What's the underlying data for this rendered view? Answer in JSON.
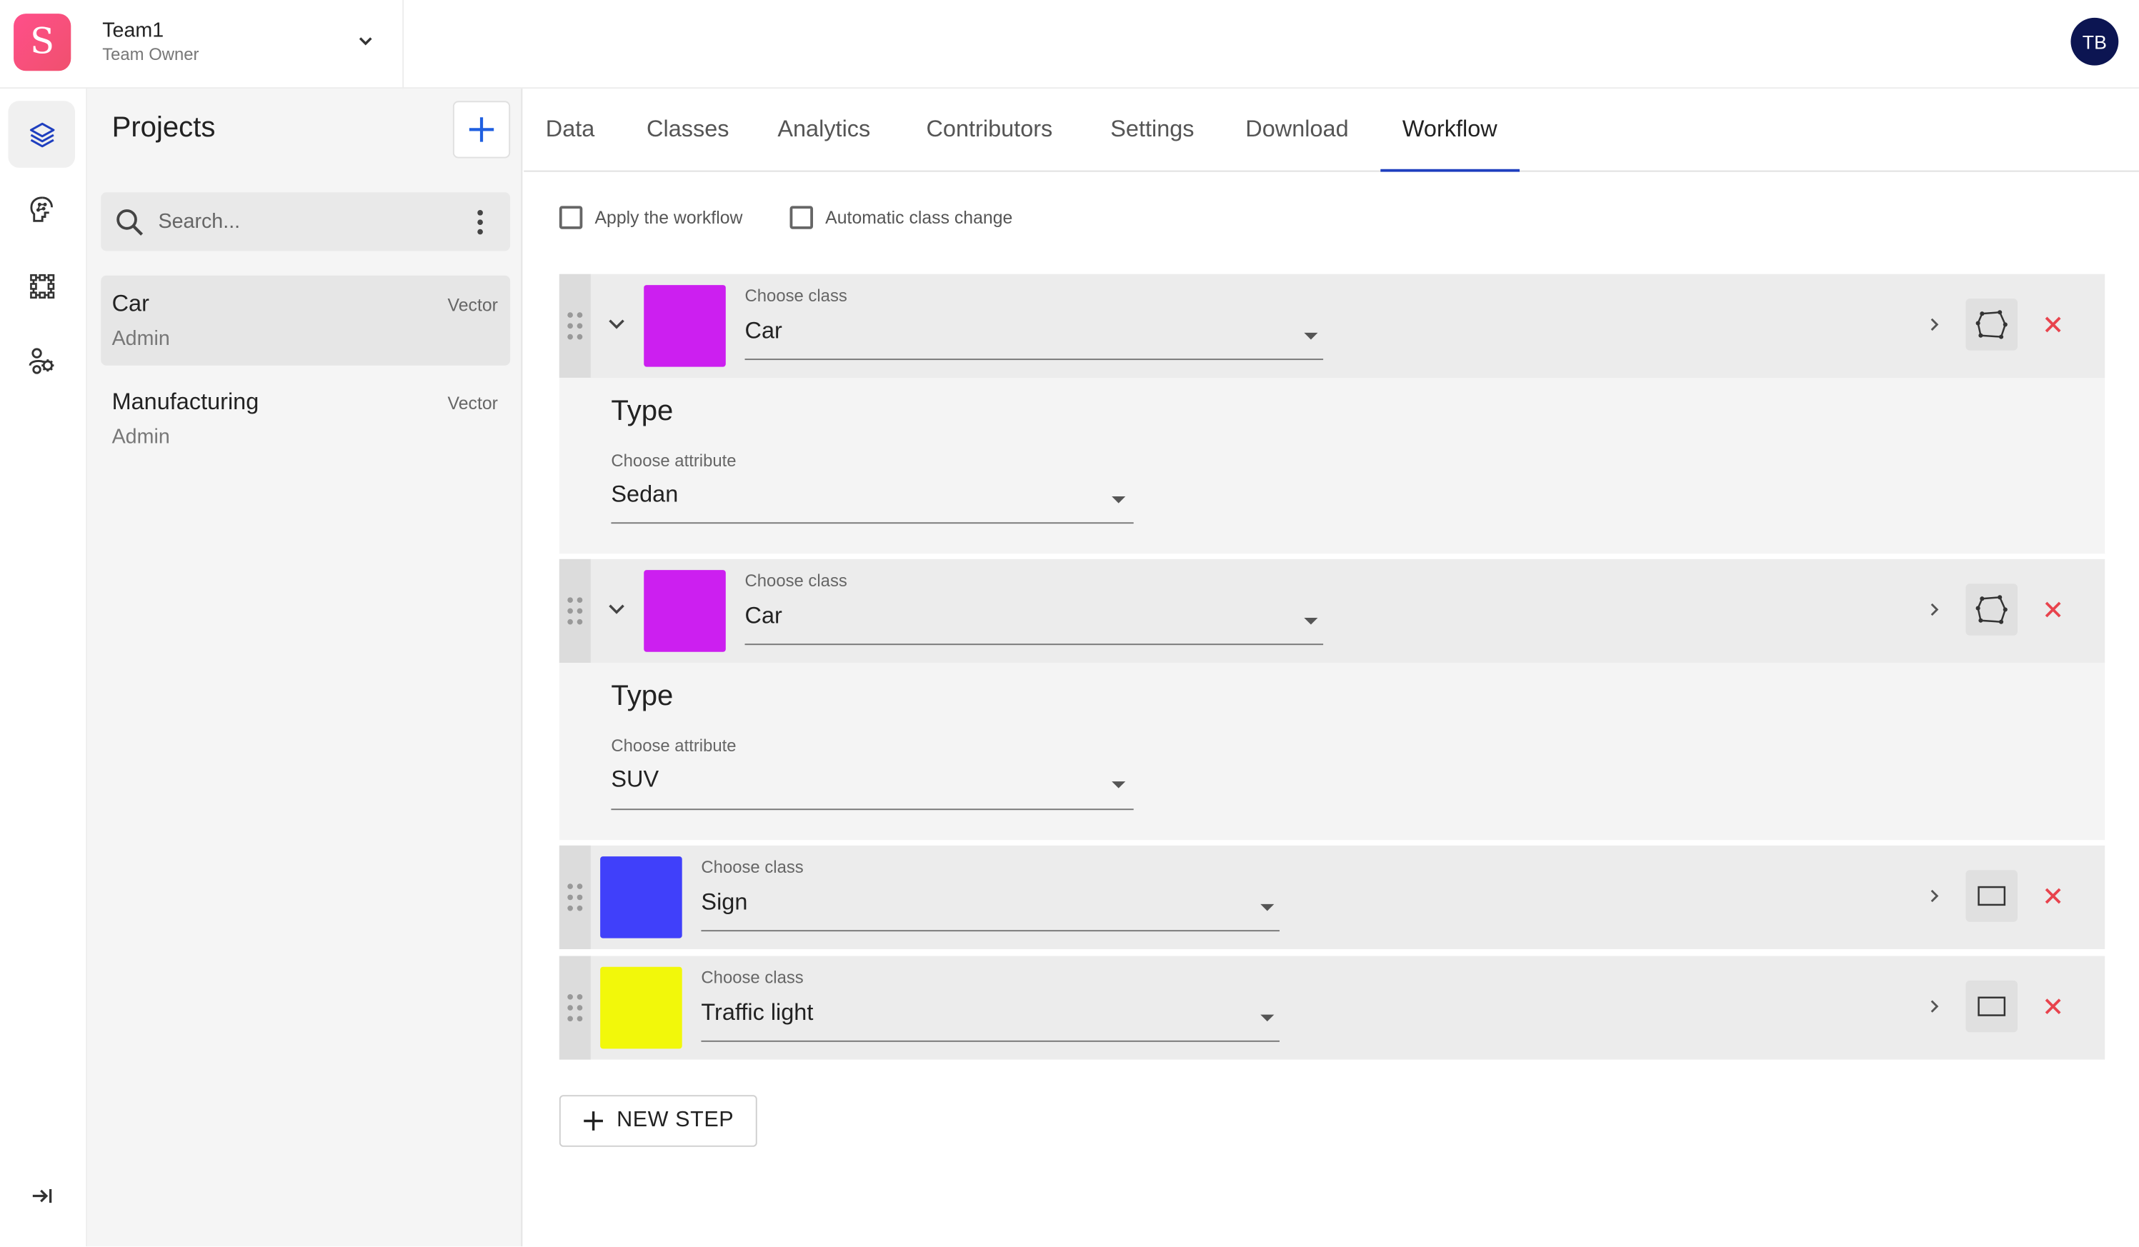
{
  "app": {
    "logo_letter": "S",
    "team_name": "Team1",
    "team_role": "Team Owner",
    "user_initials": "TB"
  },
  "rail": {
    "items": [
      {
        "icon": "layers-icon",
        "active": true
      },
      {
        "icon": "brain-icon",
        "active": false
      },
      {
        "icon": "grid-nodes-icon",
        "active": false
      },
      {
        "icon": "users-settings-icon",
        "active": false
      }
    ],
    "collapse_icon": "collapse-arrow-icon"
  },
  "projects": {
    "title": "Projects",
    "search_placeholder": "Search...",
    "items": [
      {
        "name": "Car",
        "role": "Admin",
        "type": "Vector",
        "selected": true
      },
      {
        "name": "Manufacturing",
        "role": "Admin",
        "type": "Vector",
        "selected": false
      }
    ]
  },
  "tabs": [
    "Data",
    "Classes",
    "Analytics",
    "Contributors",
    "Settings",
    "Download",
    "Workflow"
  ],
  "active_tab": "Workflow",
  "options": {
    "apply_workflow": "Apply the workflow",
    "auto_class_change": "Automatic class change"
  },
  "steps": [
    {
      "class_label": "Choose class",
      "class_value": "Car",
      "color": "#cc1ff0",
      "shape": "polygon",
      "attribute": {
        "title": "Type",
        "label": "Choose attribute",
        "value": "Sedan"
      }
    },
    {
      "class_label": "Choose class",
      "class_value": "Car",
      "color": "#cc1ff0",
      "shape": "polygon",
      "attribute": {
        "title": "Type",
        "label": "Choose attribute",
        "value": "SUV"
      }
    },
    {
      "class_label": "Choose class",
      "class_value": "Sign",
      "color": "#4040fa",
      "shape": "rectangle"
    },
    {
      "class_label": "Choose class",
      "class_value": "Traffic light",
      "color": "#f2f80a",
      "shape": "rectangle"
    }
  ],
  "new_step_label": "NEW STEP",
  "colors": {
    "accent": "#1f3fbf",
    "remove": "#e8434d",
    "avatar": "#0c1552"
  }
}
